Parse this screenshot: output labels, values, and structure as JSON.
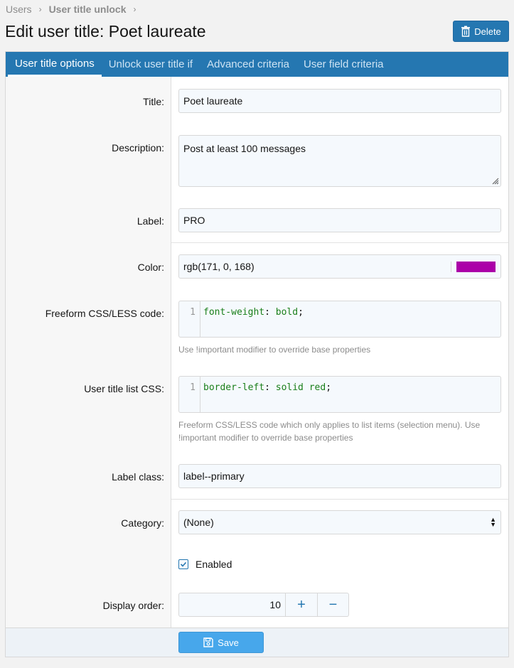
{
  "breadcrumb": {
    "items": [
      "Users",
      "User title unlock"
    ]
  },
  "page": {
    "title": "Edit user title: Poet laureate"
  },
  "actions": {
    "delete_label": "Delete",
    "save_label": "Save"
  },
  "tabs": [
    {
      "label": "User title options",
      "active": true
    },
    {
      "label": "Unlock user title if",
      "active": false
    },
    {
      "label": "Advanced criteria",
      "active": false
    },
    {
      "label": "User field criteria",
      "active": false
    }
  ],
  "form": {
    "title": {
      "label": "Title:",
      "value": "Poet laureate"
    },
    "description": {
      "label": "Description:",
      "value": "Post at least 100 messages"
    },
    "label_field": {
      "label": "Label:",
      "value": "PRO"
    },
    "color": {
      "label": "Color:",
      "value": "rgb(171, 0, 168)",
      "swatch": "#ab00a8"
    },
    "freeform_css": {
      "label": "Freeform CSS/LESS code:",
      "line_number": "1",
      "property": "font-weight",
      "colon": ":",
      "value": "bold",
      "semicolon": ";",
      "hint": "Use !important modifier to override base properties"
    },
    "list_css": {
      "label": "User title list CSS:",
      "line_number": "1",
      "property": "border-left",
      "colon": ":",
      "value": "solid red",
      "semicolon": ";",
      "hint": "Freeform CSS/LESS code which only applies to list items (selection menu). Use !important modifier to override base properties"
    },
    "label_class": {
      "label": "Label class:",
      "value": "label--primary"
    },
    "category": {
      "label": "Category:",
      "value": "(None)"
    },
    "enabled": {
      "label": "Enabled",
      "checked": true
    },
    "display_order": {
      "label": "Display order:",
      "value": "10",
      "plus": "+",
      "minus": "−"
    }
  },
  "colors": {
    "accent": "#2577b1",
    "save": "#47a7eb",
    "code_green": "#1a7f1a"
  }
}
